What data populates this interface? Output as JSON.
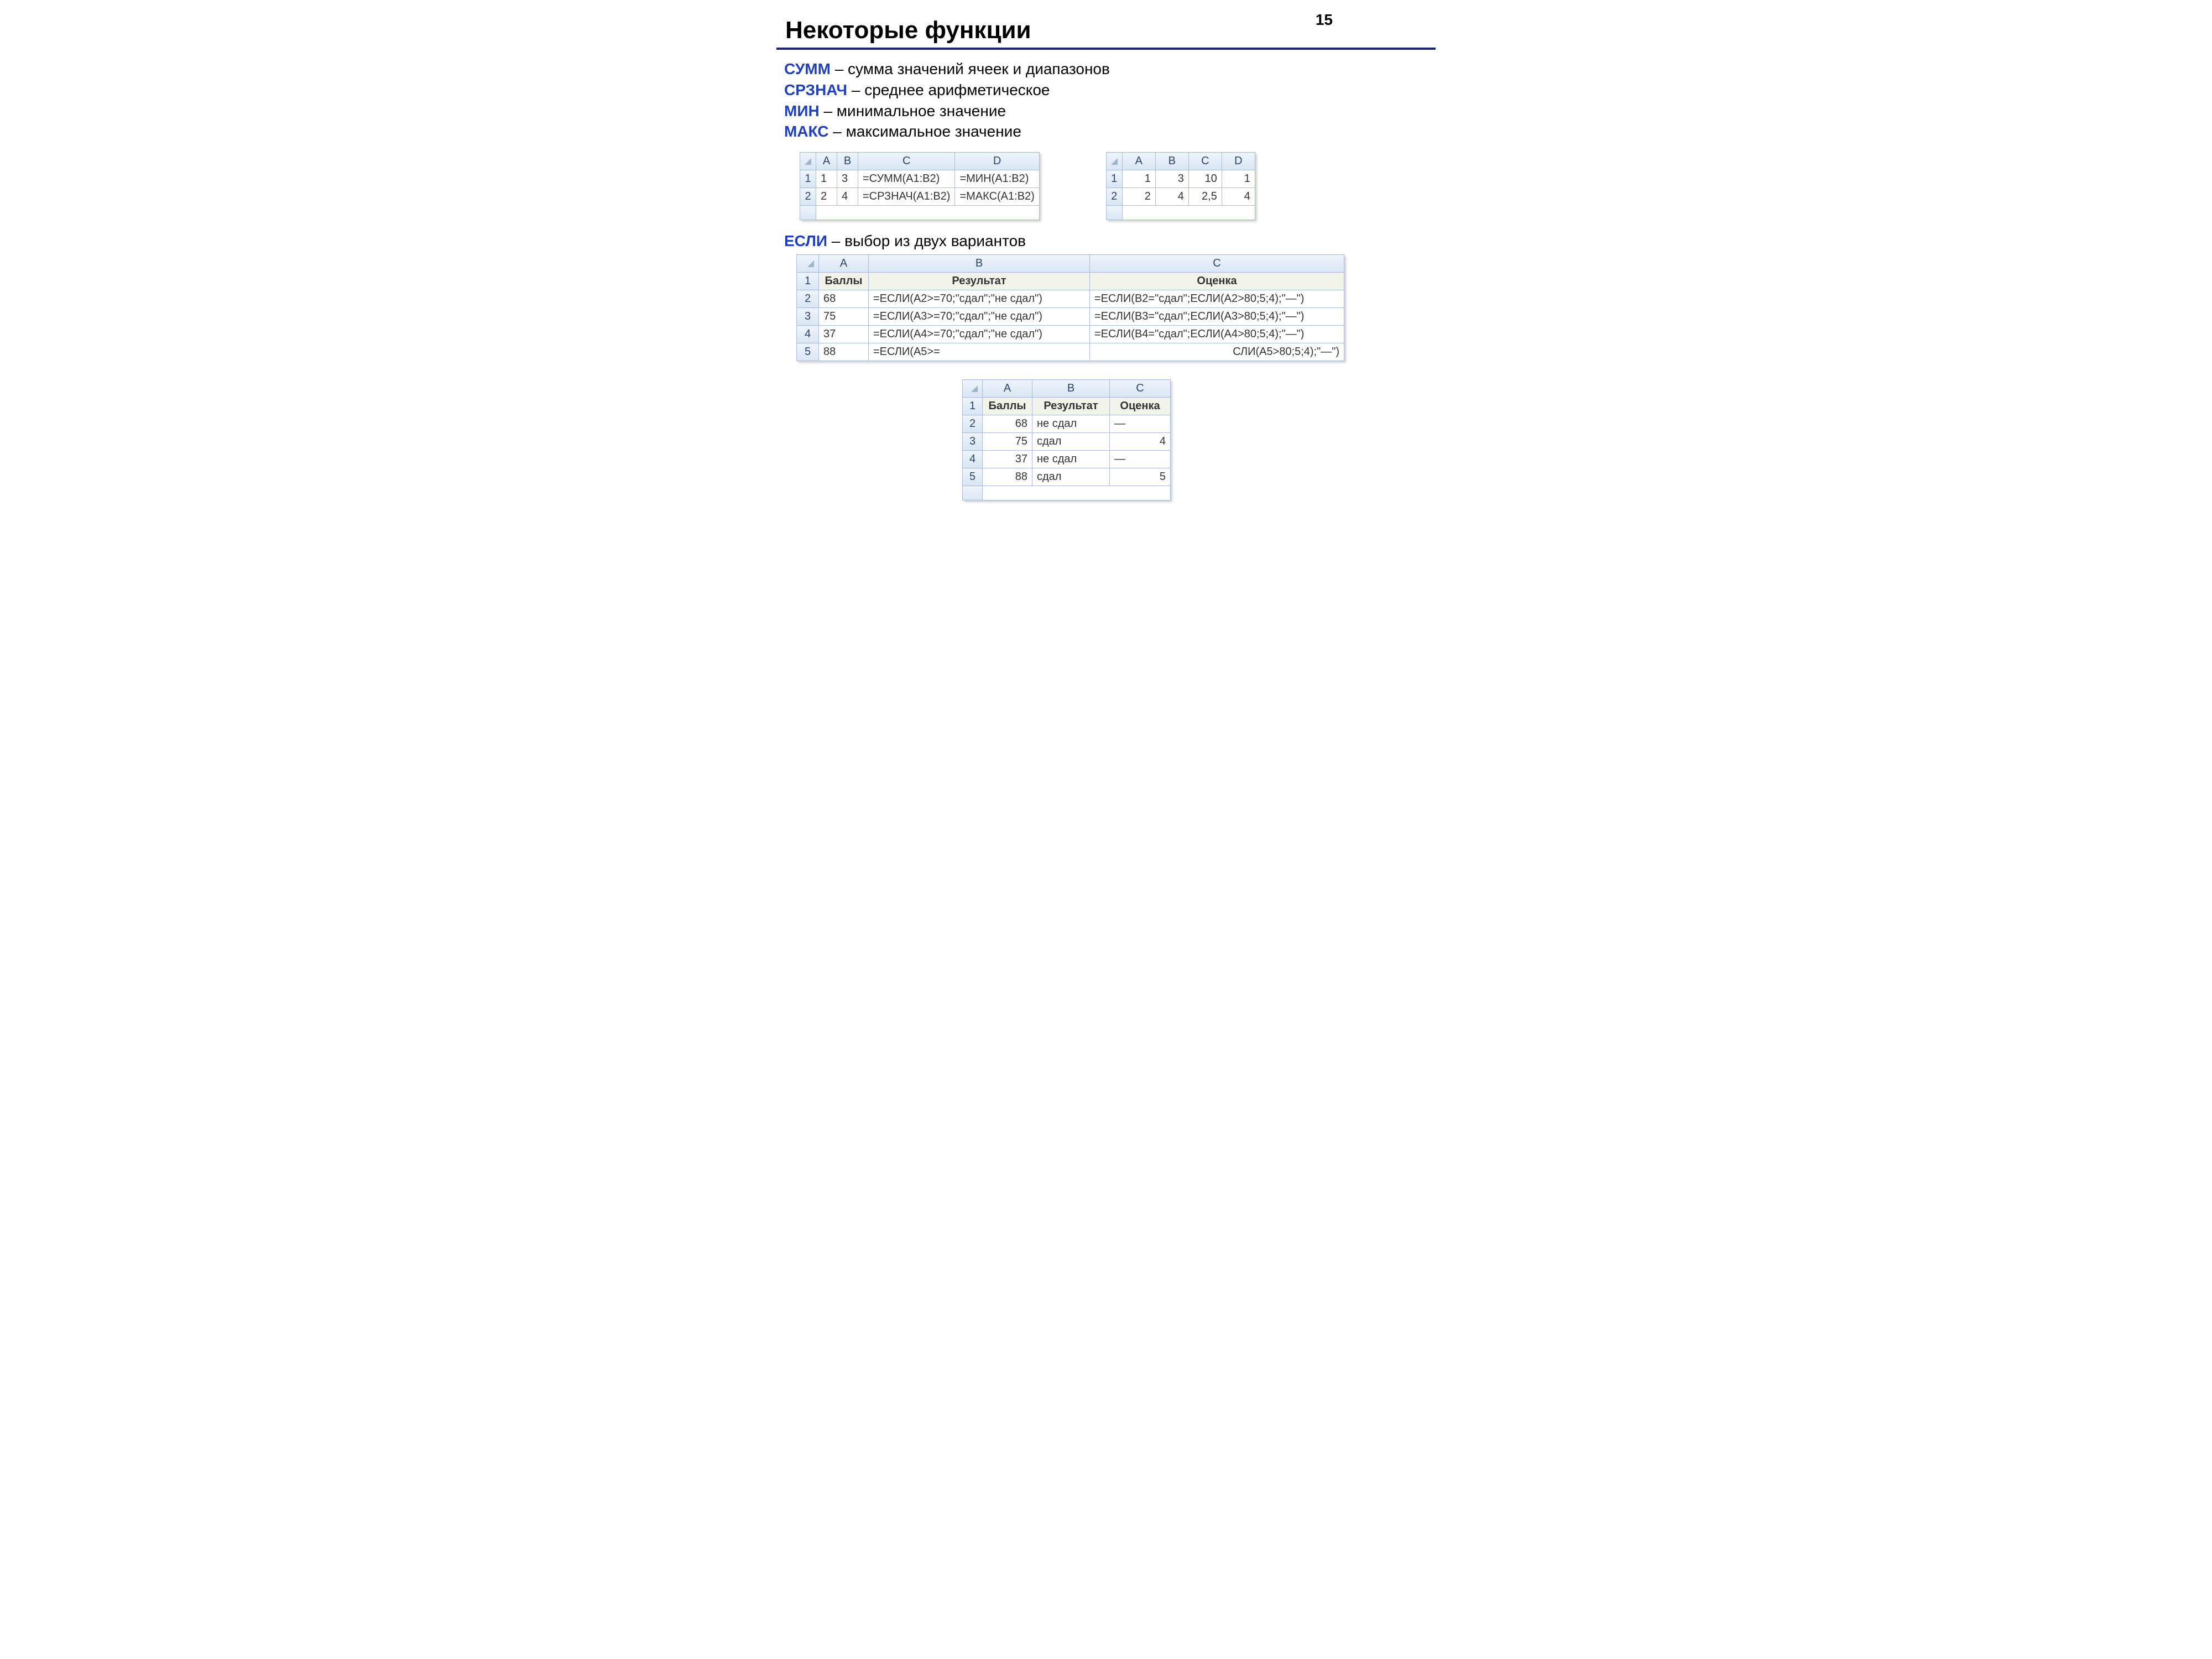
{
  "pageNumber": "15",
  "title": "Некоторые функции",
  "definitions": [
    {
      "kw": "СУММ",
      "desc": " – сумма значений ячеек и диапазонов"
    },
    {
      "kw": "СРЗНАЧ",
      "desc": " – среднее арифметическое"
    },
    {
      "kw": "МИН",
      "desc": " – минимальное значение"
    },
    {
      "kw": "МАКС",
      "desc": " – максимальное значение"
    }
  ],
  "table1": {
    "cols": [
      "A",
      "B",
      "C",
      "D"
    ],
    "rows": [
      {
        "n": "1",
        "cells": [
          "1",
          "3",
          "=СУММ(A1:B2)",
          "=МИН(A1:B2)"
        ]
      },
      {
        "n": "2",
        "cells": [
          "2",
          "4",
          "=СРЗНАЧ(A1:B2)",
          "=МАКС(A1:B2)"
        ]
      }
    ]
  },
  "table2": {
    "cols": [
      "A",
      "B",
      "C",
      "D"
    ],
    "rows": [
      {
        "n": "1",
        "cells": [
          "1",
          "3",
          "10",
          "1"
        ]
      },
      {
        "n": "2",
        "cells": [
          "2",
          "4",
          "2,5",
          "4"
        ]
      }
    ]
  },
  "ifLine": {
    "kw": "ЕСЛИ",
    "desc": " – выбор из двух вариантов"
  },
  "table3": {
    "cols": [
      "A",
      "B",
      "C"
    ],
    "header": {
      "n": "1",
      "cells": [
        "Баллы",
        "Результат",
        "Оценка"
      ]
    },
    "rows": [
      {
        "n": "2",
        "cells": [
          "68",
          "=ЕСЛИ(A2>=70;\"сдал\";\"не сдал\")",
          "=ЕСЛИ(B2=\"сдал\";ЕСЛИ(A2>80;5;4);\"—\")"
        ]
      },
      {
        "n": "3",
        "cells": [
          "75",
          "=ЕСЛИ(A3>=70;\"сдал\";\"не сдал\")",
          "=ЕСЛИ(B3=\"сдал\";ЕСЛИ(A3>80;5;4);\"—\")"
        ]
      },
      {
        "n": "4",
        "cells": [
          "37",
          "=ЕСЛИ(A4>=70;\"сдал\";\"не сдал\")",
          "=ЕСЛИ(B4=\"сдал\";ЕСЛИ(A4>80;5;4);\"—\")"
        ]
      },
      {
        "n": "5",
        "cells": [
          "88",
          "=ЕСЛИ(A5>=",
          "СЛИ(A5>80;5;4);\"—\")"
        ]
      }
    ]
  },
  "table4": {
    "cols": [
      "A",
      "B",
      "C"
    ],
    "header": {
      "n": "1",
      "cells": [
        "Баллы",
        "Результат",
        "Оценка"
      ]
    },
    "rows": [
      {
        "n": "2",
        "cells": [
          "68",
          "не сдал",
          "—"
        ]
      },
      {
        "n": "3",
        "cells": [
          "75",
          "сдал",
          "4"
        ]
      },
      {
        "n": "4",
        "cells": [
          "37",
          "не сдал",
          "—"
        ]
      },
      {
        "n": "5",
        "cells": [
          "88",
          "сдал",
          "5"
        ]
      }
    ]
  }
}
